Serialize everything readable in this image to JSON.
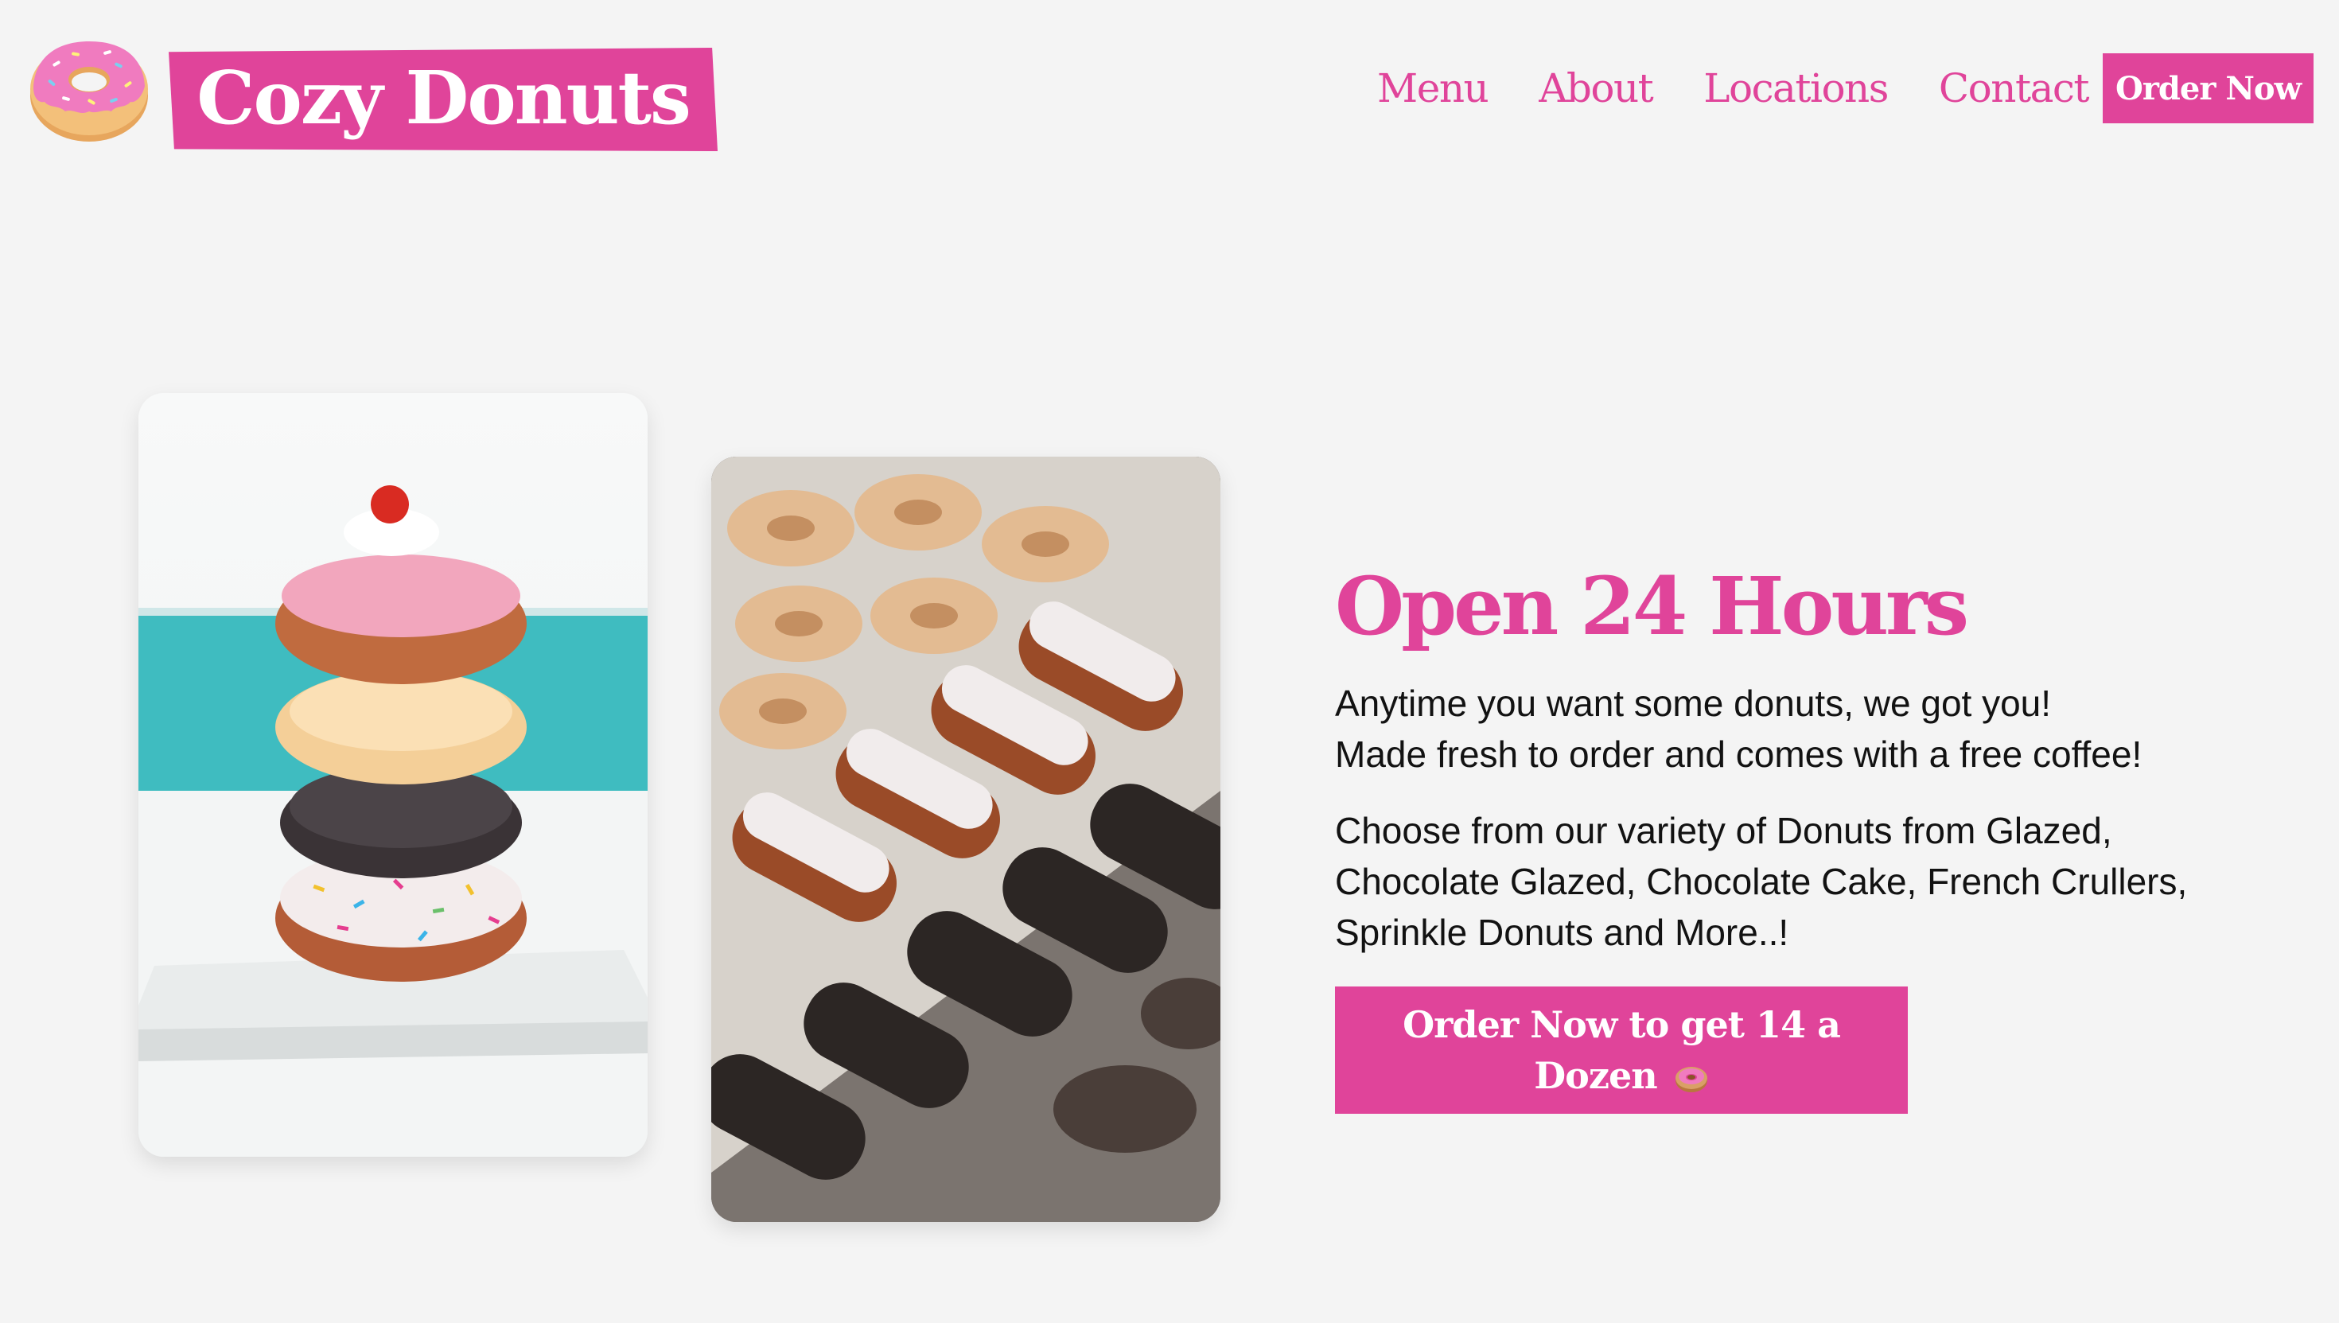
{
  "header": {
    "brand_name": "Cozy Donuts",
    "logo_icon": "donut-icon"
  },
  "nav": {
    "items": [
      {
        "label": "Menu"
      },
      {
        "label": "About"
      },
      {
        "label": "Locations"
      },
      {
        "label": "Contact"
      }
    ],
    "order_label": "Order Now"
  },
  "hero": {
    "title": "Open 24 Hours",
    "tagline_line1": "Anytime you want some donuts, we got you!",
    "tagline_line2": "Made fresh to order and comes with a free coffee!",
    "variety_text": "Choose from our variety of Donuts from Glazed, Chocolate Glazed, Chocolate Cake, French Crullers, Sprinkle Donuts and More..!",
    "cta_label": "Order Now to get 14 a Dozen",
    "cta_icon": "donut-emoji-icon"
  },
  "images": {
    "stack": "stacked-donuts-photo",
    "tray": "donut-tray-photo"
  },
  "colors": {
    "brand_pink": "#e0449a",
    "background": "#f4f4f4",
    "text": "#121212"
  }
}
